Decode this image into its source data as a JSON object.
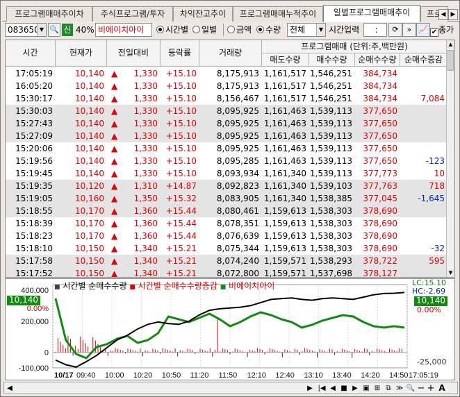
{
  "tabs": {
    "items": [
      "프로그램매매추이차",
      "주식프로그램/투자",
      "차익잔고추이",
      "프로그램매매누적추이",
      "일별프로그램매매추이",
      "프로"
    ],
    "active_index": 4
  },
  "toolbar": {
    "code": "083650",
    "market_badge": "신",
    "margin_rate": "40%",
    "stock_name": "비에이치아이",
    "radio_time": "시간별",
    "radio_day": "일별",
    "radio_amount": "금액",
    "radio_qty": "수량",
    "type_select": "전체",
    "time_input_label": "시간입력",
    "time_input_value": ":",
    "check_label": "종가"
  },
  "grid": {
    "columns": [
      "시간",
      "현재가",
      "전일대비",
      "등락률",
      "거래량"
    ],
    "group_header": "프로그램매매 (단위:주,백만원)",
    "sub_columns": [
      "매도수량",
      "매수수량",
      "순매수수량",
      "순매수증감"
    ],
    "rows": [
      {
        "time": "17:05:19",
        "price": "10,140",
        "change": "1,330",
        "rate": "+15.10",
        "volume": "8,175,913",
        "sell": "1,161,517",
        "buy": "1,546,251",
        "net": "384,734",
        "delta": "",
        "shade": false
      },
      {
        "time": "16:05:20",
        "price": "10,140",
        "change": "1,330",
        "rate": "+15.10",
        "volume": "8,175,913",
        "sell": "1,161,517",
        "buy": "1,546,251",
        "net": "384,734",
        "delta": "",
        "shade": false
      },
      {
        "time": "15:30:17",
        "price": "10,140",
        "change": "1,330",
        "rate": "+15.10",
        "volume": "8,156,467",
        "sell": "1,161,517",
        "buy": "1,546,251",
        "net": "384,734",
        "delta": "7,084",
        "shade": false
      },
      {
        "time": "15:30:03",
        "price": "10,140",
        "change": "1,330",
        "rate": "+15.10",
        "volume": "8,095,925",
        "sell": "1,161,463",
        "buy": "1,539,113",
        "net": "377,650",
        "delta": "",
        "shade": true
      },
      {
        "time": "15:27:43",
        "price": "10,140",
        "change": "1,330",
        "rate": "+15.10",
        "volume": "8,095,925",
        "sell": "1,161,463",
        "buy": "1,539,113",
        "net": "377,650",
        "delta": "",
        "shade": true
      },
      {
        "time": "15:27:09",
        "price": "10,140",
        "change": "1,330",
        "rate": "+15.10",
        "volume": "8,095,925",
        "sell": "1,161,463",
        "buy": "1,539,113",
        "net": "377,650",
        "delta": "",
        "shade": true
      },
      {
        "time": "15:20:06",
        "price": "10,140",
        "change": "1,330",
        "rate": "+15.10",
        "volume": "8,095,925",
        "sell": "1,161,463",
        "buy": "1,539,113",
        "net": "377,650",
        "delta": "",
        "shade": false
      },
      {
        "time": "15:19:56",
        "price": "10,140",
        "change": "1,330",
        "rate": "+15.10",
        "volume": "8,095,285",
        "sell": "1,161,463",
        "buy": "1,539,113",
        "net": "377,650",
        "delta": "-123",
        "shade": false
      },
      {
        "time": "15:19:45",
        "price": "10,140",
        "change": "1,330",
        "rate": "+15.10",
        "volume": "8,093,934",
        "sell": "1,161,340",
        "buy": "1,539,113",
        "net": "377,773",
        "delta": "10",
        "shade": false
      },
      {
        "time": "15:19:35",
        "price": "10,120",
        "change": "1,310",
        "rate": "+14.87",
        "volume": "8,092,823",
        "sell": "1,161,340",
        "buy": "1,539,103",
        "net": "377,763",
        "delta": "718",
        "shade": true
      },
      {
        "time": "15:19:05",
        "price": "10,160",
        "change": "1,350",
        "rate": "+15.32",
        "volume": "8,083,905",
        "sell": "1,161,340",
        "buy": "1,538,385",
        "net": "377,045",
        "delta": "-1,645",
        "shade": true
      },
      {
        "time": "15:18:55",
        "price": "10,170",
        "change": "1,360",
        "rate": "+15.44",
        "volume": "8,080,461",
        "sell": "1,159,613",
        "buy": "1,538,303",
        "net": "378,690",
        "delta": "",
        "shade": true
      },
      {
        "time": "15:18:39",
        "price": "10,170",
        "change": "1,360",
        "rate": "+15.44",
        "volume": "8,078,351",
        "sell": "1,159,613",
        "buy": "1,538,303",
        "net": "378,690",
        "delta": "",
        "shade": false
      },
      {
        "time": "15:18:23",
        "price": "10,170",
        "change": "1,360",
        "rate": "+15.44",
        "volume": "8,076,639",
        "sell": "1,159,613",
        "buy": "1,538,303",
        "net": "378,690",
        "delta": "",
        "shade": false
      },
      {
        "time": "15:18:10",
        "price": "10,150",
        "change": "1,340",
        "rate": "+15.21",
        "volume": "8,075,344",
        "sell": "1,159,613",
        "buy": "1,538,303",
        "net": "378,690",
        "delta": "-32",
        "shade": false
      },
      {
        "time": "15:17:58",
        "price": "10,150",
        "change": "1,340",
        "rate": "+15.21",
        "volume": "8,074,240",
        "sell": "1,159,571",
        "buy": "1,538,293",
        "net": "378,722",
        "delta": "595",
        "shade": true
      },
      {
        "time": "15:17:52",
        "price": "10,150",
        "change": "1,340",
        "rate": "+15.21",
        "volume": "8,072,800",
        "sell": "1,159,571",
        "buy": "1,537,698",
        "net": "378,127",
        "delta": "",
        "shade": true
      }
    ]
  },
  "chart_data": {
    "type": "line",
    "legend": [
      "시간별 순매수수량",
      "시간별 순매수수량증감",
      "비에이치아이"
    ],
    "colors": {
      "net": "#000000",
      "delta_up": "#e00000",
      "delta_down": "#0026c8",
      "price": "#108a10"
    },
    "left_axis_ticks": [
      "400,000",
      "200,000",
      "0",
      "-100,000"
    ],
    "left_price_labels": [
      "10,140",
      "0.00%"
    ],
    "right_labels": {
      "lc": "LC:15.10",
      "hc": "HC:-2.69",
      "price_tag": "10,140",
      "pct": "0.00%",
      "bottom": "-25,000"
    },
    "left_price_tag": "10,140",
    "x_ticks": [
      "10/17",
      "09:40",
      "10:00",
      "10:20",
      "10:50",
      "11:20",
      "11:50",
      "12:10",
      "12:40",
      "13:10",
      "13:40",
      "14:20",
      "14:50",
      "17:05:19"
    ],
    "net_series": [
      -50000,
      -80000,
      -95000,
      -60000,
      -20000,
      30000,
      80000,
      110000,
      150000,
      180000,
      195000,
      185000,
      180000,
      200000,
      240000,
      270000,
      280000,
      285000,
      290000,
      300000,
      320000,
      340000,
      345000,
      350000,
      340000,
      335000,
      345000,
      350000,
      345000,
      340000,
      355000,
      370000,
      378000,
      380000,
      385000
    ],
    "price_series": [
      10350,
      10050,
      9950,
      9920,
      10000,
      10020,
      10060,
      10080,
      10030,
      10050,
      10100,
      10220,
      10200,
      10180,
      10210,
      10240,
      10200,
      10150,
      10180,
      10220,
      10250,
      10230,
      10200,
      10180,
      10140,
      10160,
      10190,
      10210,
      10230,
      10220,
      10180,
      10150,
      10140,
      10150,
      10140
    ]
  },
  "bottom": {
    "scroll_left": "◀",
    "scroll_right": "▶",
    "labels": [
      "◀",
      "▶",
      "■",
      "▶"
    ]
  }
}
